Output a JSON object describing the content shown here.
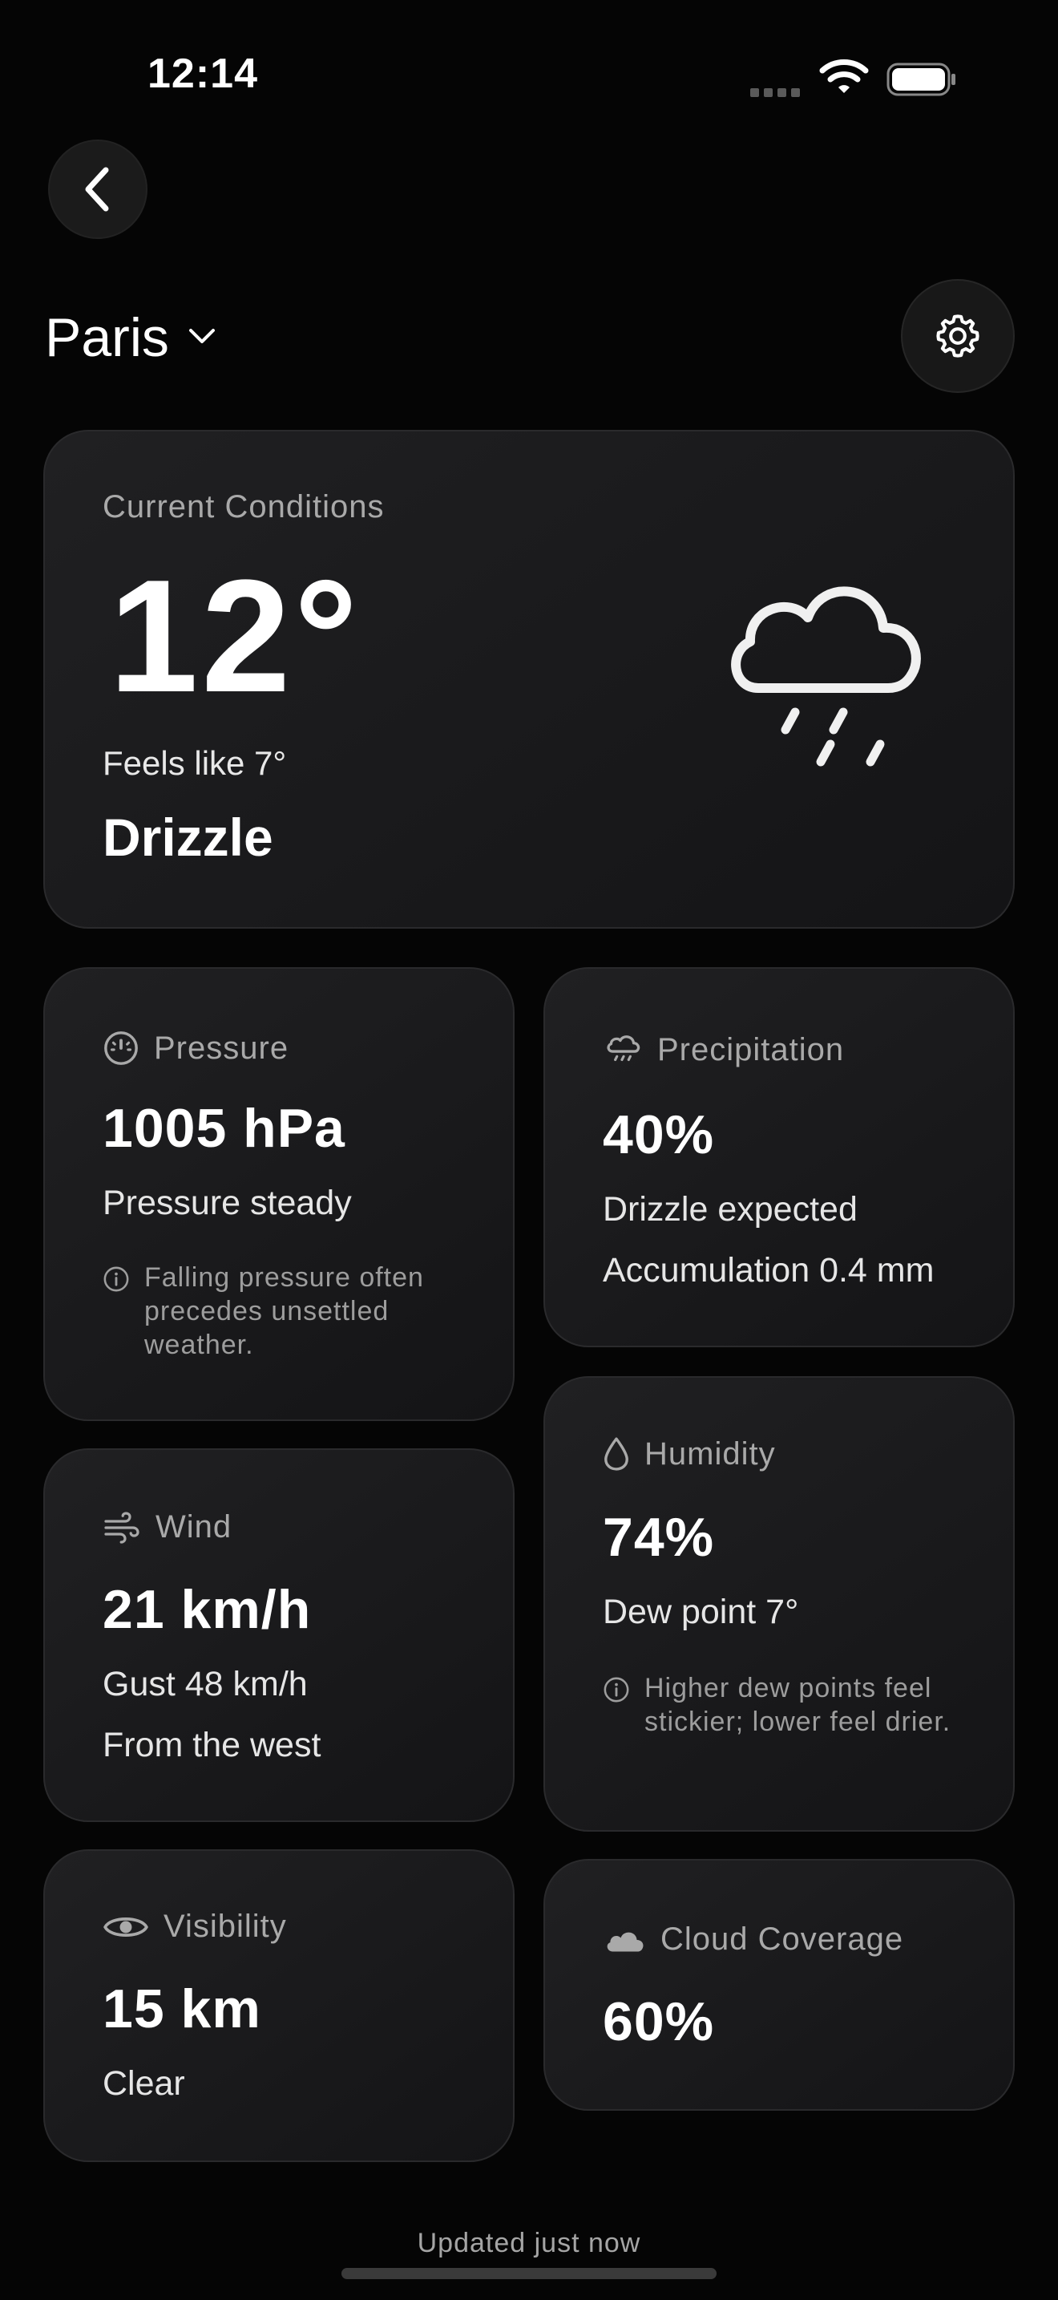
{
  "status_bar": {
    "time": "12:14"
  },
  "header": {
    "city": "Paris"
  },
  "current": {
    "label": "Current Conditions",
    "temperature": "12°",
    "feels_like": "Feels like 7°",
    "condition": "Drizzle",
    "icon": "cloud-drizzle-icon"
  },
  "pressure": {
    "label": "Pressure",
    "value": "1005 hPa",
    "trend": "Pressure steady",
    "note": "Falling pressure often precedes unsettled weather."
  },
  "precipitation": {
    "label": "Precipitation",
    "value": "40%",
    "detail": "Drizzle expected",
    "accumulation": "Accumulation 0.4 mm"
  },
  "wind": {
    "label": "Wind",
    "value": "21 km/h",
    "gust": "Gust 48 km/h",
    "direction": "From the west"
  },
  "humidity": {
    "label": "Humidity",
    "value": "74%",
    "dew_point": "Dew point 7°",
    "note": "Higher dew points feel stickier; lower feel drier."
  },
  "visibility": {
    "label": "Visibility",
    "value": "15 km",
    "detail": "Clear"
  },
  "cloud_coverage": {
    "label": "Cloud Coverage",
    "value": "60%"
  },
  "footer": {
    "updated": "Updated just now"
  },
  "colors": {
    "background": "#050505",
    "card": "#1a1a1c",
    "label": "#a9a9a9"
  }
}
